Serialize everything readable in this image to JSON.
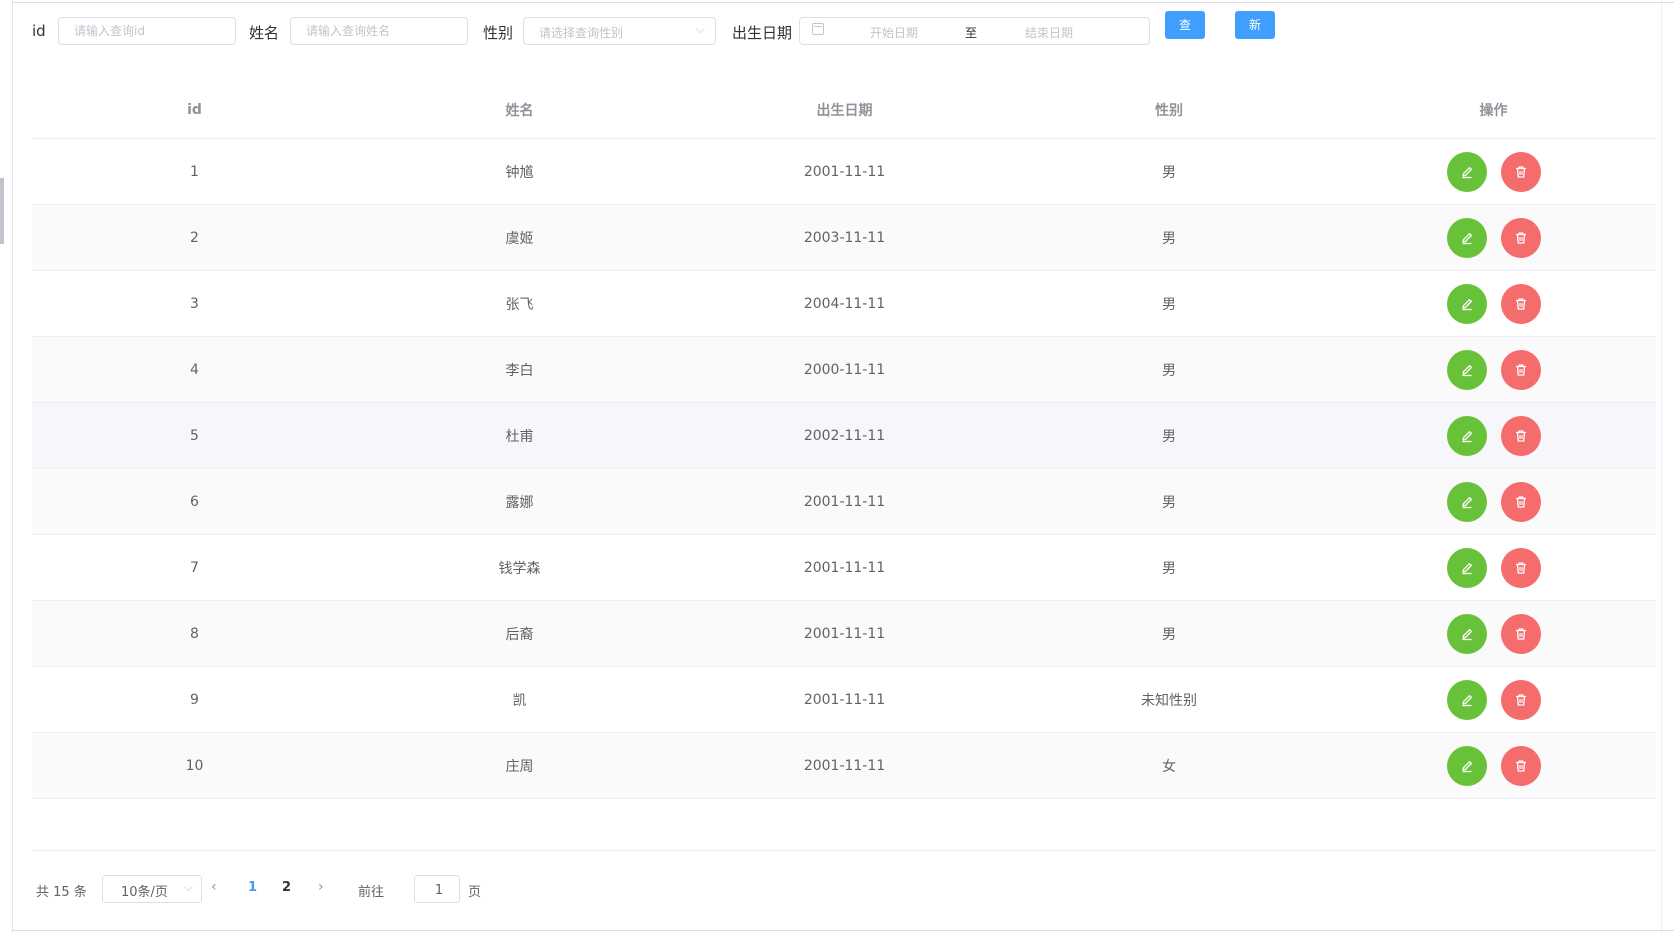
{
  "search": {
    "id_label": "id",
    "id_placeholder": "请输入查询id",
    "name_label": "姓名",
    "name_placeholder": "请输入查询姓名",
    "gender_label": "性别",
    "gender_placeholder": "请选择查询性别",
    "birth_label": "出生日期",
    "date_start_placeholder": "开始日期",
    "date_separator": "至",
    "date_end_placeholder": "结束日期",
    "query_button": "查询",
    "add_button": "新增"
  },
  "table": {
    "headers": [
      "id",
      "姓名",
      "出生日期",
      "性别",
      "操作"
    ],
    "rows": [
      {
        "id": "1",
        "name": "钟馗",
        "birth": "2001-11-11",
        "gender": "男"
      },
      {
        "id": "2",
        "name": "虞姬",
        "birth": "2003-11-11",
        "gender": "男"
      },
      {
        "id": "3",
        "name": "张飞",
        "birth": "2004-11-11",
        "gender": "男"
      },
      {
        "id": "4",
        "name": "李白",
        "birth": "2000-11-11",
        "gender": "男"
      },
      {
        "id": "5",
        "name": "杜甫",
        "birth": "2002-11-11",
        "gender": "男"
      },
      {
        "id": "6",
        "name": "露娜",
        "birth": "2001-11-11",
        "gender": "男"
      },
      {
        "id": "7",
        "name": "钱学森",
        "birth": "2001-11-11",
        "gender": "男"
      },
      {
        "id": "8",
        "name": "后裔",
        "birth": "2001-11-11",
        "gender": "男"
      },
      {
        "id": "9",
        "name": "凯",
        "birth": "2001-11-11",
        "gender": "未知性别"
      },
      {
        "id": "10",
        "name": "庄周",
        "birth": "2001-11-11",
        "gender": "女"
      }
    ],
    "edit_icon": "edit-pencil-icon",
    "delete_icon": "trash-icon",
    "colors": {
      "edit": "#67c23a",
      "delete": "#f56c6c",
      "primary": "#409eff"
    }
  },
  "pagination": {
    "total_text": "共 15 条",
    "page_size": "10条/页",
    "pages": [
      "1",
      "2"
    ],
    "current_page": "1",
    "goto_prefix": "前往",
    "goto_value": "1",
    "goto_suffix": "页"
  }
}
